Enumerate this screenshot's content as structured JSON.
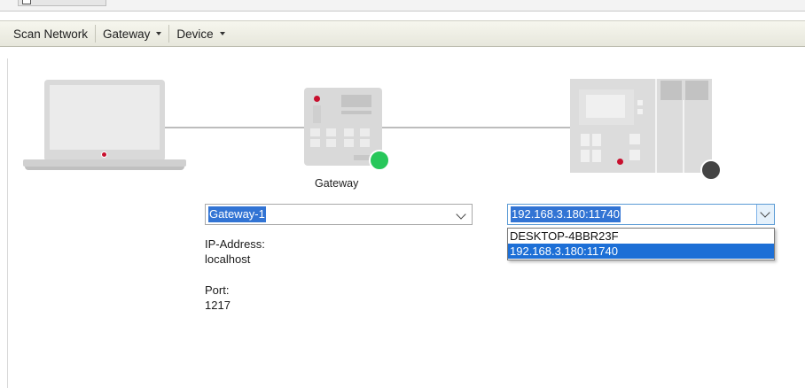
{
  "toolbar": {
    "scan_network": "Scan Network",
    "gateway_menu": "Gateway",
    "device_menu": "Device"
  },
  "diagram": {
    "gateway_label": "Gateway",
    "gateway_status_color": "#27c75a",
    "device_status_color": "#444444"
  },
  "gateway_select": {
    "value": "Gateway-1"
  },
  "gateway_info": {
    "ip_label": "IP-Address:",
    "ip_value": "localhost",
    "port_label": "Port:",
    "port_value": "1217"
  },
  "device_select": {
    "value": "192.168.3.180:11740",
    "options": [
      "DESKTOP-4BBR23F",
      "192.168.3.180:11740"
    ],
    "selected_index": 1
  }
}
